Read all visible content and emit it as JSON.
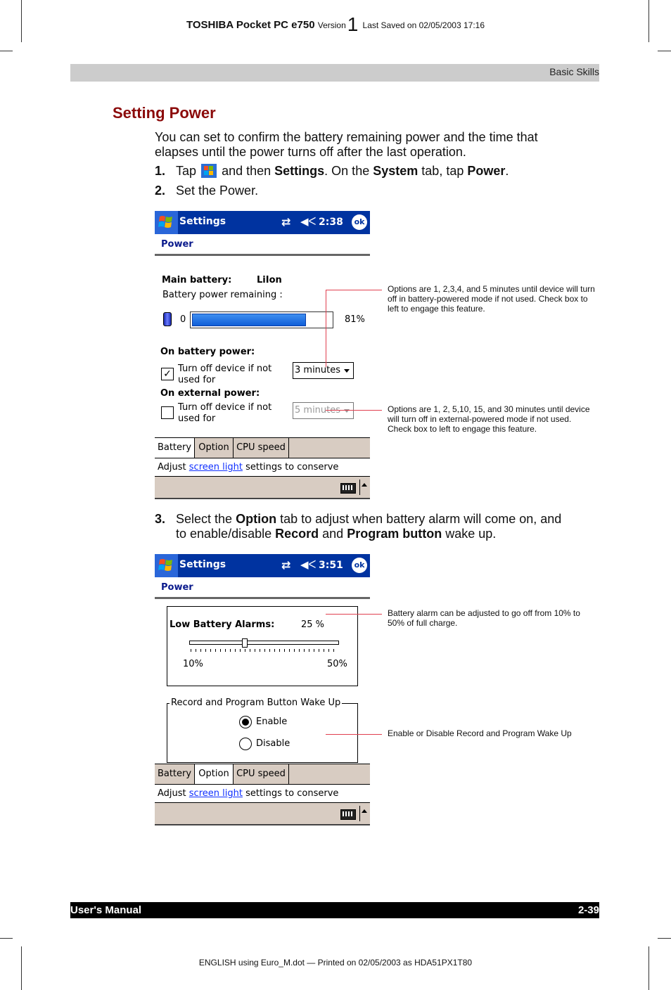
{
  "header": {
    "brand": "TOSHIBA Pocket PC e750",
    "version_label": "Version",
    "version_number": "1",
    "last_saved": "Last Saved on 02/05/2003 17:16"
  },
  "section": "Basic Skills",
  "title": "Setting Power",
  "intro": "You can set to confirm the battery remaining power and the time that elapses until the power turns off after the last operation.",
  "steps": [
    {
      "num": "1.",
      "parts": [
        "Tap",
        "and then",
        "Settings",
        ". On the",
        "System",
        "tab, tap",
        "Power",
        "."
      ]
    },
    {
      "num": "2.",
      "text": "Set the Power."
    },
    {
      "num": "3.",
      "parts": [
        "Select the",
        "Option",
        "tab to adjust when battery alarm will come on, and",
        "to enable/disable",
        "Record",
        "and",
        "Program button",
        "wake up."
      ]
    }
  ],
  "screen1": {
    "app_title": "Settings",
    "time": "2:38",
    "ok_label": "ok",
    "connectivity_icon": "sync-arrows-icon",
    "volume_icon": "speaker-icon",
    "subtitle": "Power",
    "main_battery_label": "Main battery:",
    "main_battery_type": "LiIon",
    "remaining_label": "Battery power remaining :",
    "progress_min": "0",
    "battery_percent": 81,
    "battery_percent_label": "81%",
    "on_battery_label": "On battery power:",
    "on_battery_checkbox_label_1": "Turn off device if not",
    "on_battery_checkbox_label_2": "used for",
    "on_battery_checked": true,
    "on_battery_value": "3 minutes",
    "on_external_label": "On external power:",
    "on_external_checkbox_label_1": "Turn off device if not",
    "on_external_checkbox_label_2": "used for",
    "on_external_checked": false,
    "on_external_value": "5 minutes",
    "tabs": [
      "Battery",
      "Option",
      "CPU speed"
    ],
    "active_tab": "Battery",
    "help_prefix": "Adjust",
    "help_link": "screen light",
    "help_suffix": "settings to conserve power."
  },
  "screen2": {
    "app_title": "Settings",
    "time": "3:51",
    "ok_label": "ok",
    "subtitle": "Power",
    "alarm_label": "Low Battery Alarms:",
    "alarm_value_label": "25 %",
    "alarm_value": 25,
    "slider_min_label": "10%",
    "slider_max_label": "50%",
    "slider_min": 10,
    "slider_max": 50,
    "wake_group_label": "Record and Program Button Wake Up",
    "radio_enable": "Enable",
    "radio_disable": "Disable",
    "selected_radio": "Enable",
    "tabs": [
      "Battery",
      "Option",
      "CPU speed"
    ],
    "active_tab": "Option",
    "help_prefix": "Adjust",
    "help_link": "screen light",
    "help_suffix": "settings to conserve power."
  },
  "annotations": {
    "battery_timeout": "Options are 1, 2,3,4, and 5 minutes until device will turn off in battery-powered mode if not used. Check box to left to engage this feature.",
    "external_timeout": "Options are 1, 2, 5,10, 15, and 30 minutes until device will turn off in external-powered mode if not used. Check box to left to engage this feature.",
    "alarm": "Battery alarm can be adjusted to go off from 10% to 50% of full charge.",
    "wake": "Enable or Disable Record and Program Wake Up"
  },
  "footer": {
    "left": "User's Manual",
    "right": "2-39",
    "printed": "ENGLISH using Euro_M.dot — Printed on 02/05/2003 as HDA51PX1T80"
  },
  "colors": {
    "title": "#8b0a0a",
    "titlebar": "#0033a0",
    "link": "#1030ff",
    "leader": "#e04050",
    "tab_bg": "#d8ccc2"
  }
}
